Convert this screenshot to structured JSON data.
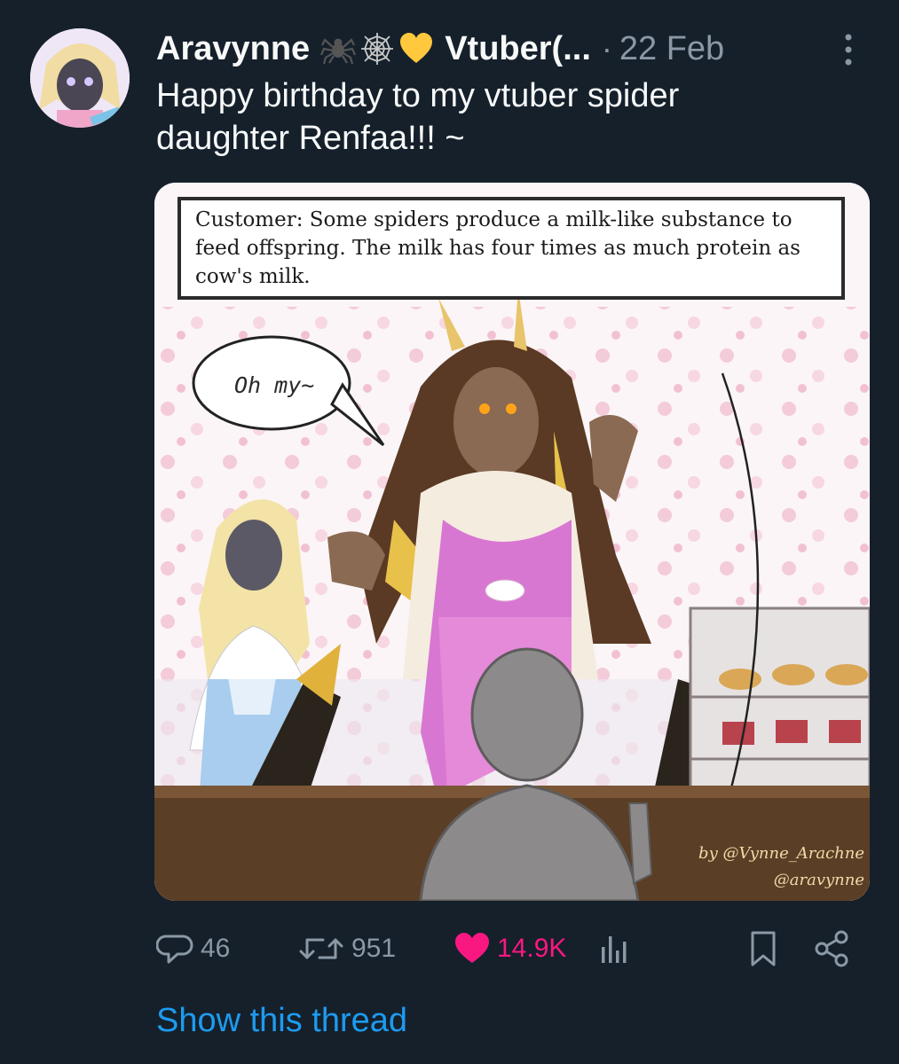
{
  "tweet": {
    "author": {
      "display_name": "Aravynne",
      "emojis": [
        "spider-icon",
        "spider-web-icon",
        "yellow-heart-icon"
      ],
      "name_suffix": "Vtuber(...",
      "avatar": "avatar-image"
    },
    "separator": "·",
    "date": "22 Feb",
    "text": "Happy birthday to my vtuber spider\ndaughter Renfaa!!! ~",
    "media": {
      "caption": "Customer: Some spiders produce a milk-like substance to feed offspring. The milk has four times as much protein as cow's milk.",
      "speech_bubble": "Oh my~",
      "credit_line1": "by @Vynne_Arachne",
      "credit_line2": "@aravynne"
    },
    "actions": {
      "replies": "46",
      "retweets": "951",
      "likes": "14.9K",
      "like_color": "#f91880"
    },
    "show_thread": "Show this thread"
  },
  "colors": {
    "background": "#15202b",
    "primary_text": "#f7f9f9",
    "secondary_text": "#8b98a5",
    "link": "#1d9bf0"
  }
}
